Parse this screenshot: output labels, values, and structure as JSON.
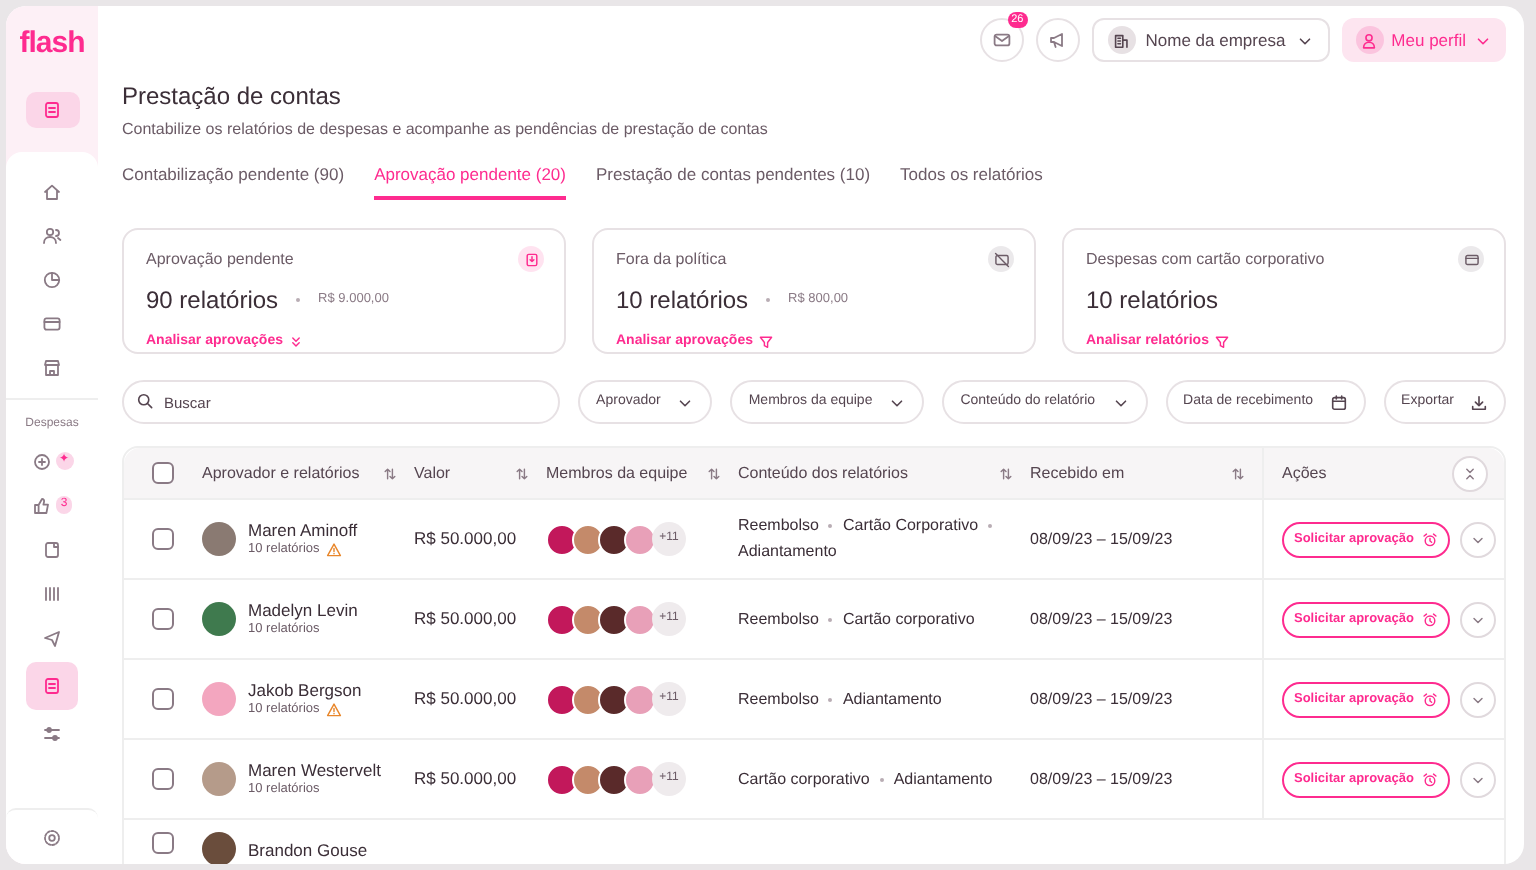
{
  "sidebar": {
    "logo": "flash",
    "top_item": {
      "selected": true
    },
    "items": [
      {
        "selected": false
      },
      {
        "selected": false
      },
      {
        "selected": false
      },
      {
        "selected": false
      },
      {
        "selected": false
      }
    ],
    "section_label": "Despesas",
    "section_items": [
      {
        "selected": false,
        "badge": "✦"
      },
      {
        "selected": false,
        "badge": "3"
      },
      {
        "selected": false
      },
      {
        "selected": false
      },
      {
        "selected": false
      },
      {
        "selected": true
      },
      {
        "selected": false
      }
    ]
  },
  "header": {
    "mail_badge": "26",
    "company": "Nome da empresa",
    "profile": "Meu perfil"
  },
  "page": {
    "title": "Prestação de contas",
    "subtitle": "Contabilize os relatórios de despesas e acompanhe as pendências de prestação de contas"
  },
  "tabs": [
    {
      "label": "Contabilização pendente (90)",
      "selected": false
    },
    {
      "label": "Aprovação pendente (20)",
      "selected": true
    },
    {
      "label": "Prestação de contas pendentes (10)",
      "selected": false
    },
    {
      "label": "Todos os relatórios",
      "selected": false
    }
  ],
  "cards": [
    {
      "title": "Aprovação pendente",
      "count": "90 relatórios",
      "amount": "R$ 9.000,00",
      "link": "Analisar aprovações",
      "color": "#fe2b8f"
    },
    {
      "title": "Fora da política",
      "count": "10 relatórios",
      "amount": "R$ 800,00",
      "link": "Analisar aprovações",
      "color": "#6b5b66"
    },
    {
      "title": "Despesas com cartão corporativo",
      "count": "10 relatórios",
      "link": "Analisar relatórios",
      "color": "#6b5b66"
    }
  ],
  "filters": {
    "search": {
      "placeholder": "Buscar"
    },
    "dropdowns": [
      "Aprovador",
      "Membros da equipe",
      "Conteúdo do relatório"
    ],
    "date": "Data de recebimento",
    "export": "Exportar"
  },
  "table": {
    "all_checked": false,
    "columns": [
      "Aprovador e relatórios",
      "Valor",
      "Membros da equipe",
      "Conteúdo dos relatórios",
      "Recebido em",
      "Ações"
    ],
    "rows": [
      {
        "name": "Maren Aminoff",
        "reports": "10 relatórios",
        "warning": true,
        "value": "R$ 50.000,00",
        "members_more": "+11",
        "content": [
          "Reembolso",
          "Cartão Corporativo",
          "Adiantamento"
        ],
        "received": "08/09/23 – 15/09/23",
        "action": "Solicitar aprovação",
        "checked": false
      },
      {
        "name": "Madelyn Levin",
        "reports": "10 relatórios",
        "warning": false,
        "value": "R$ 50.000,00",
        "members_more": "+11",
        "content": [
          "Reembolso",
          "Cartão corporativo"
        ],
        "received": "08/09/23 – 15/09/23",
        "action": "Solicitar aprovação",
        "checked": false
      },
      {
        "name": "Jakob Bergson",
        "reports": "10 relatórios",
        "warning": true,
        "value": "R$ 50.000,00",
        "members_more": "+11",
        "content": [
          "Reembolso",
          "Adiantamento"
        ],
        "received": "08/09/23 – 15/09/23",
        "action": "Solicitar aprovação",
        "checked": false
      },
      {
        "name": "Maren Westervelt",
        "reports": "10 relatórios",
        "warning": false,
        "value": "R$ 50.000,00",
        "members_more": "+11",
        "content": [
          "Cartão corporativo",
          "Adiantamento"
        ],
        "received": "08/09/23 – 15/09/23",
        "action": "Solicitar aprovação",
        "checked": false
      },
      {
        "name": "Brandon Gouse",
        "checked": false
      }
    ]
  }
}
